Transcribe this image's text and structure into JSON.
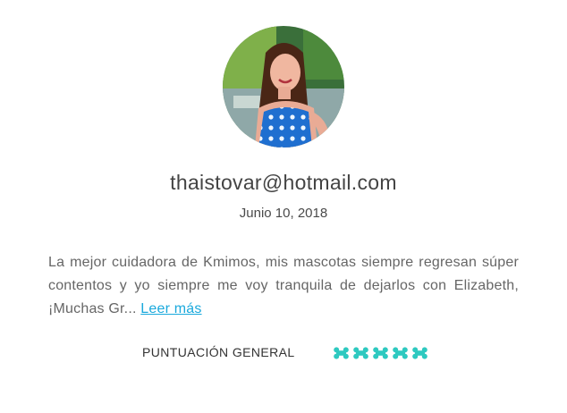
{
  "review": {
    "reviewer_email": "thaistovar@hotmail.com",
    "date": "Junio 10, 2018",
    "text": "La mejor cuidadora de Kmimos, mis mascotas siempre regresan súper contentos y yo siempre me voy tranquila de dejarlos con Elizabeth, ¡Muchas Gr...",
    "read_more_label": "Leer más"
  },
  "rating": {
    "label": "PUNTUACIÓN GENERAL",
    "score": 5,
    "max": 5,
    "icon": "dog-bone-icon",
    "color": "#2ec9c0"
  }
}
